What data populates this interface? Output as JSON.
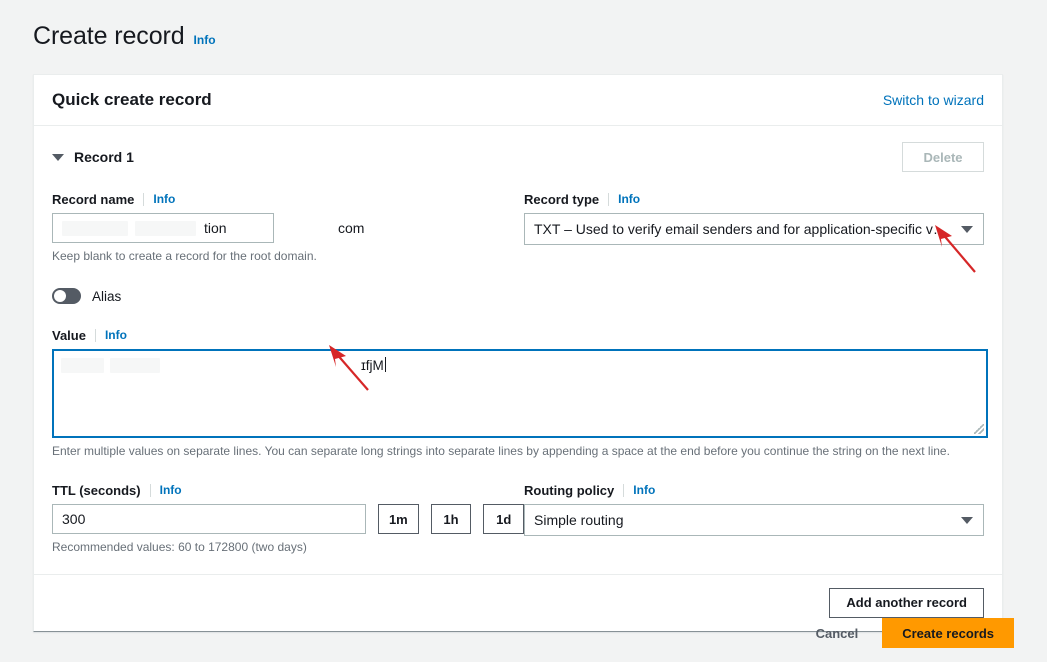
{
  "page": {
    "title": "Create record",
    "info_label": "Info"
  },
  "card": {
    "header_title": "Quick create record",
    "switch_link": "Switch to wizard"
  },
  "record": {
    "collapse_label": "Record 1",
    "delete_label": "Delete",
    "name": {
      "label": "Record name",
      "info": "Info",
      "value_visible": "tion",
      "redacted": true,
      "domain_suffix": "com",
      "hint": "Keep blank to create a record for the root domain."
    },
    "type": {
      "label": "Record type",
      "info": "Info",
      "selected": "TXT – Used to verify email senders and for application-specific values"
    },
    "alias": {
      "label": "Alias",
      "enabled": false
    },
    "value": {
      "label": "Value",
      "info": "Info",
      "visible_text": "ɪfjM",
      "redacted": true,
      "focused": true,
      "hint": "Enter multiple values on separate lines. You can separate long strings into separate lines by appending a space at the end before you continue the string on the next line."
    },
    "ttl": {
      "label": "TTL (seconds)",
      "info": "Info",
      "value": "300",
      "presets": [
        "1m",
        "1h",
        "1d"
      ],
      "hint": "Recommended values: 60 to 172800 (two days)"
    },
    "routing": {
      "label": "Routing policy",
      "info": "Info",
      "selected": "Simple routing"
    }
  },
  "footer": {
    "add_another": "Add another record"
  },
  "actions": {
    "cancel": "Cancel",
    "create": "Create records"
  },
  "colors": {
    "accent_link": "#0073bb",
    "primary_button": "#ff9900",
    "focus_border": "#0073bb",
    "annotation_arrow": "#d62728",
    "page_background": "#f2f3f3"
  }
}
